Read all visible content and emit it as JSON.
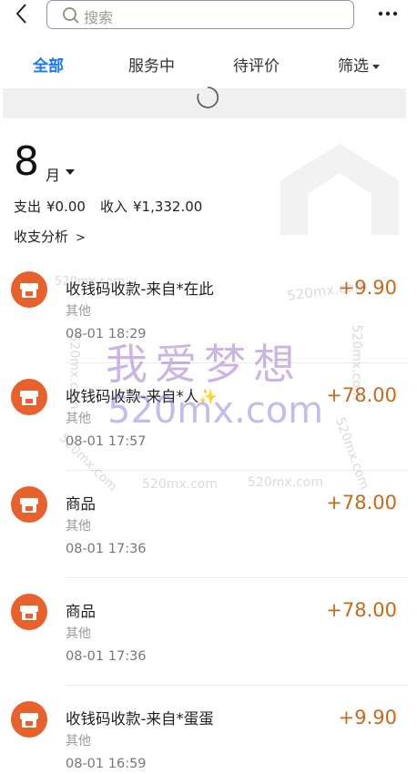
{
  "search": {
    "placeholder": "搜索"
  },
  "tabs": [
    {
      "label": "全部",
      "active": true
    },
    {
      "label": "服务中",
      "active": false
    },
    {
      "label": "待评价",
      "active": false
    },
    {
      "label": "筛选",
      "active": false
    }
  ],
  "summary": {
    "month": "8",
    "month_unit": "月",
    "expense_label": "支出",
    "expense": "¥0.00",
    "income_label": "收入",
    "income": "¥1,332.00",
    "analysis_label": "收支分析",
    "analysis_chevron": ">"
  },
  "transactions": [
    {
      "title": "收钱码收款-来自*在此",
      "category": "其他",
      "time": "08-01 18:29",
      "amount": "+9.90"
    },
    {
      "title": "收钱码收款-来自*人✨",
      "category": "其他",
      "time": "08-01 17:57",
      "amount": "+78.00"
    },
    {
      "title": "商品",
      "category": "其他",
      "time": "08-01 17:36",
      "amount": "+78.00"
    },
    {
      "title": "商品",
      "category": "其他",
      "time": "08-01 17:36",
      "amount": "+78.00"
    },
    {
      "title": "收钱码收款-来自*蛋蛋",
      "category": "其他",
      "time": "08-01 16:59",
      "amount": "+9.90"
    }
  ],
  "watermark": {
    "big_text": "我爱梦想",
    "big_domain": "520mx.com",
    "small": "520mx.com"
  },
  "colors": {
    "accent": "#1677ff",
    "amount": "#c46a1a",
    "avatar": "#e8602c"
  }
}
